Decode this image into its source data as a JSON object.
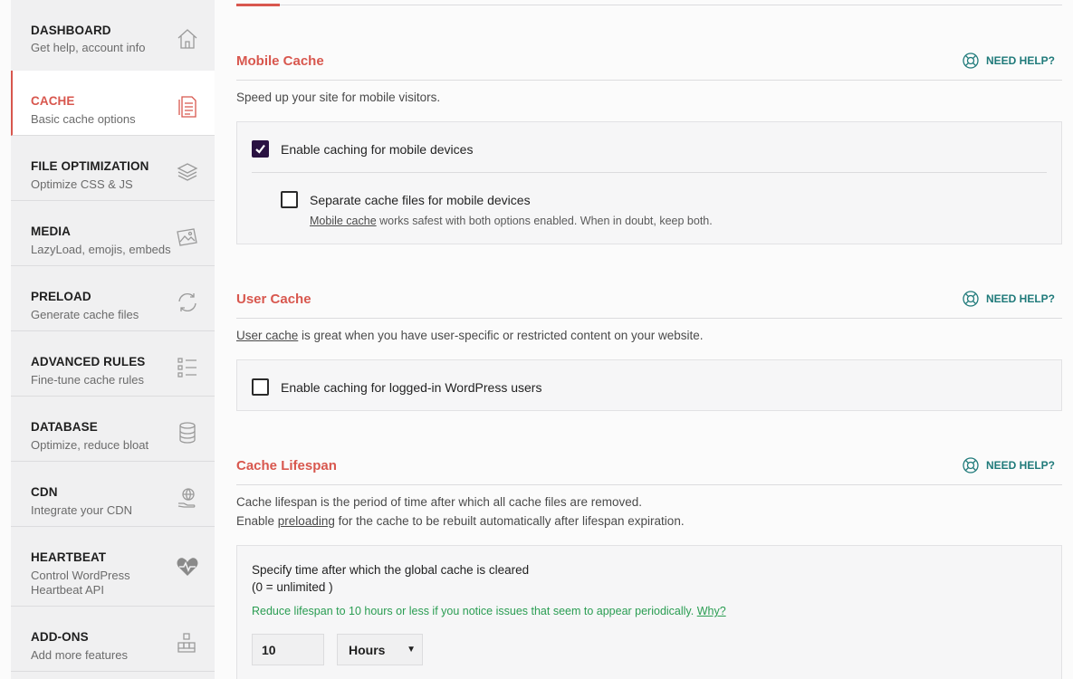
{
  "sidebar": {
    "items": [
      {
        "title": "DASHBOARD",
        "desc": "Get help, account info",
        "icon": "home-icon"
      },
      {
        "title": "CACHE",
        "desc": "Basic cache options",
        "icon": "file-icon"
      },
      {
        "title": "FILE OPTIMIZATION",
        "desc": "Optimize CSS & JS",
        "icon": "layers-icon"
      },
      {
        "title": "MEDIA",
        "desc": "LazyLoad, emojis, embeds",
        "icon": "image-icon"
      },
      {
        "title": "PRELOAD",
        "desc": "Generate cache files",
        "icon": "refresh-icon"
      },
      {
        "title": "ADVANCED RULES",
        "desc": "Fine-tune cache rules",
        "icon": "list-icon"
      },
      {
        "title": "DATABASE",
        "desc": "Optimize, reduce bloat",
        "icon": "database-icon"
      },
      {
        "title": "CDN",
        "desc": "Integrate your CDN",
        "icon": "globe-hand-icon"
      },
      {
        "title": "HEARTBEAT",
        "desc": "Control WordPress Heartbeat API",
        "icon": "heartbeat-icon"
      },
      {
        "title": "ADD-ONS",
        "desc": "Add more features",
        "icon": "cubes-icon"
      }
    ],
    "active_index": 1
  },
  "help_label": "NEED HELP?",
  "mobile": {
    "title": "Mobile Cache",
    "description": "Speed up your site for mobile visitors.",
    "enable_label": "Enable caching for mobile devices",
    "enable_checked": true,
    "separate_label": "Separate cache files for mobile devices",
    "separate_checked": false,
    "note_link": "Mobile cache",
    "note_rest": " works safest with both options enabled. When in doubt, keep both."
  },
  "user": {
    "title": "User Cache",
    "desc_link": "User cache",
    "desc_rest": " is great when you have user-specific or restricted content on your website.",
    "enable_label": "Enable caching for logged-in WordPress users",
    "enable_checked": false
  },
  "lifespan": {
    "title": "Cache Lifespan",
    "line1": "Cache lifespan is the period of time after which all cache files are removed.",
    "line2_pre": "Enable ",
    "line2_link": "preloading",
    "line2_post": " for the cache to be rebuilt automatically after lifespan expiration.",
    "field_label": "Specify time after which the global cache is cleared",
    "field_sub": "(0 = unlimited )",
    "warning": "Reduce lifespan to 10 hours or less if you notice issues that seem to appear periodically. ",
    "warning_link": "Why?",
    "value": "10",
    "unit": "Hours"
  },
  "colors": {
    "accent": "#d8574e",
    "help": "#1f7a7a",
    "checkbox": "#2a1242",
    "warning": "#2a9d52"
  }
}
